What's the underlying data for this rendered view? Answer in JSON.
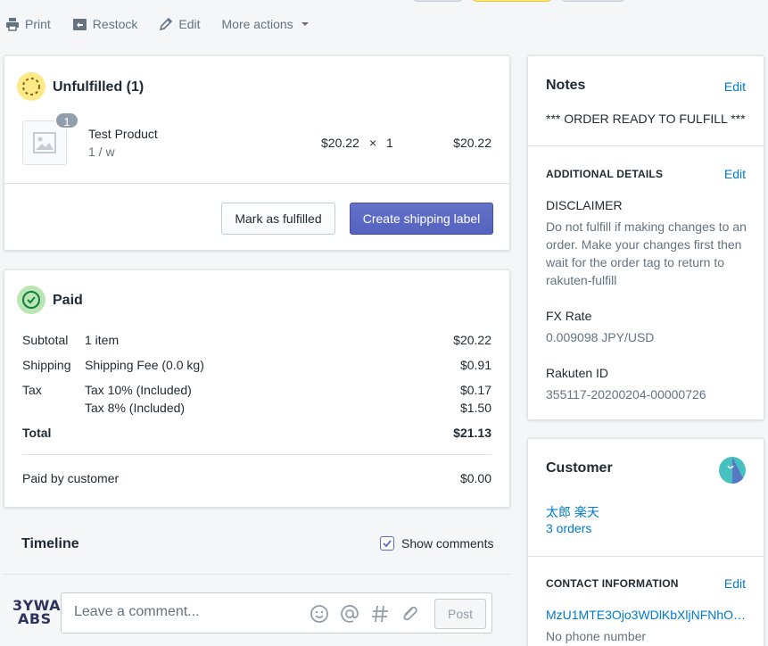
{
  "toolbar": {
    "print": "Print",
    "restock": "Restock",
    "edit": "Edit",
    "more_actions": "More actions"
  },
  "unfulfilled": {
    "title": "Unfulfilled (1)",
    "item": {
      "quantity_badge": "1",
      "name": "Test Product",
      "variant": "1 / w",
      "price": "$20.22",
      "times": "×",
      "qty": "1",
      "total": "$20.22"
    },
    "mark_fulfilled": "Mark as fulfilled",
    "create_label": "Create shipping label"
  },
  "paid": {
    "title": "Paid",
    "rows": {
      "subtotal": {
        "label": "Subtotal",
        "desc": "1 item",
        "amount": "$20.22"
      },
      "shipping": {
        "label": "Shipping",
        "desc": "Shipping Fee (0.0 kg)",
        "amount": "$0.91"
      },
      "tax": {
        "label": "Tax",
        "desc1": "Tax 10% (Included)",
        "amount1": "$0.17",
        "desc2": "Tax 8% (Included)",
        "amount2": "$1.50"
      },
      "total": {
        "label": "Total",
        "amount": "$21.13"
      }
    },
    "paid_by_customer": {
      "label": "Paid by customer",
      "amount": "$0.00"
    }
  },
  "timeline": {
    "title": "Timeline",
    "show_comments": "Show comments",
    "show_comments_checked": true,
    "avatar_text_1": "3YWA",
    "avatar_text_2": "ABS",
    "comment_placeholder": "Leave a comment...",
    "post": "Post"
  },
  "notes": {
    "title": "Notes",
    "edit": "Edit",
    "note": "*** ORDER READY TO FULFILL ***"
  },
  "additional_details": {
    "title": "ADDITIONAL DETAILS",
    "edit": "Edit",
    "disclaimer_label": "DISCLAIMER",
    "disclaimer_line1": "Do not fulfill if making changes to an",
    "disclaimer_line2": "order. Make your changes first then",
    "disclaimer_line3": "wait for the order tag to return to",
    "disclaimer_line4": "rakuten-fulfill",
    "fx_label": "FX Rate",
    "fx_value": "0.009098 JPY/USD",
    "rakuten_label": "Rakuten ID",
    "rakuten_value": "355117-20200204-00000726"
  },
  "customer": {
    "title": "Customer",
    "name": "太郎 楽天",
    "orders": "3 orders",
    "contact_title": "CONTACT INFORMATION",
    "contact_edit": "Edit",
    "email": "MzU1MTE3Ojo3WDlKbXljNFNhOjo...",
    "phone": "No phone number"
  },
  "colors": {
    "accent": "#5c6ac4",
    "link": "#007ace",
    "unfulfilled_badge": "#ffea8a",
    "paid_badge": "#bbe5b3"
  }
}
